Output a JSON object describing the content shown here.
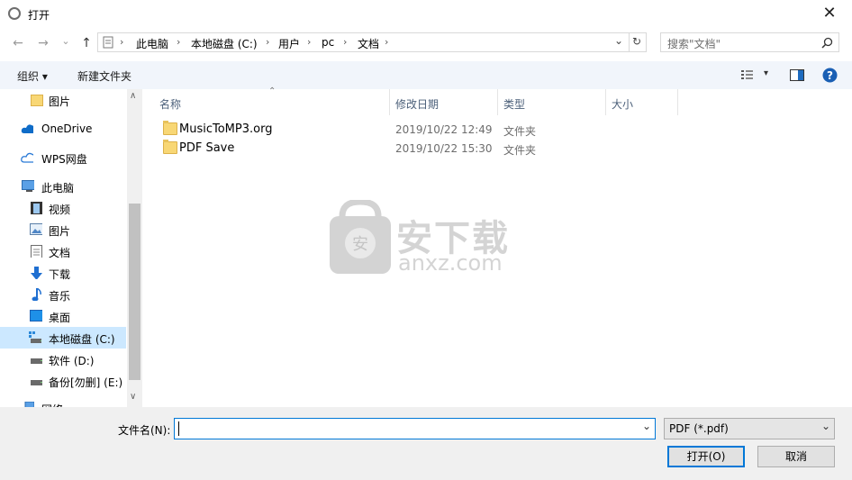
{
  "window": {
    "title": "打开",
    "close_glyph": "✕"
  },
  "nav": {
    "back": "←",
    "forward": "→",
    "recent": "⌄",
    "up": "↑",
    "address": [
      "此电脑",
      "本地磁盘 (C:)",
      "用户",
      "pc",
      "文档"
    ],
    "address_dropdown": "⌄",
    "refresh": "↻"
  },
  "search": {
    "placeholder": "搜索\"文档\"",
    "icon": "search-icon"
  },
  "toolbar": {
    "organize": "组织 ▾",
    "new_folder": "新建文件夹",
    "view_toggle": "▾"
  },
  "sidebar": {
    "items": [
      {
        "label": "图片",
        "icon": "folder-icon"
      },
      {
        "label": "OneDrive",
        "icon": "cloud-icon"
      },
      {
        "label": "WPS网盘",
        "icon": "cloud-outline-icon"
      },
      {
        "label": "此电脑",
        "icon": "computer-icon"
      },
      {
        "label": "视频",
        "icon": "video-icon"
      },
      {
        "label": "图片",
        "icon": "pictures-icon"
      },
      {
        "label": "文档",
        "icon": "document-icon"
      },
      {
        "label": "下载",
        "icon": "download-icon"
      },
      {
        "label": "音乐",
        "icon": "music-icon"
      },
      {
        "label": "桌面",
        "icon": "desktop-icon"
      },
      {
        "label": "本地磁盘 (C:)",
        "icon": "drive-icon",
        "selected": true
      },
      {
        "label": "软件 (D:)",
        "icon": "drive-icon"
      },
      {
        "label": "备份[勿删] (E:)",
        "icon": "drive-icon"
      },
      {
        "label": "网络",
        "icon": "network-icon"
      }
    ]
  },
  "columns": {
    "name": "名称",
    "modified": "修改日期",
    "type": "类型",
    "size": "大小"
  },
  "files": [
    {
      "name": "MusicToMP3.org",
      "modified": "2019/10/22 12:49",
      "type": "文件夹"
    },
    {
      "name": "PDF Save",
      "modified": "2019/10/22 15:30",
      "type": "文件夹"
    }
  ],
  "watermark": {
    "text_cn": "安下载",
    "text_en": "anxz.com"
  },
  "footer": {
    "filename_label": "文件名(N):",
    "filename_value": "",
    "filter": "PDF (*.pdf)",
    "open_label": "打开(O)",
    "cancel_label": "取消"
  },
  "colors": {
    "accent": "#0078d7",
    "toolbar_bg": "#f1f5fb",
    "selected_bg": "#cce8ff"
  }
}
